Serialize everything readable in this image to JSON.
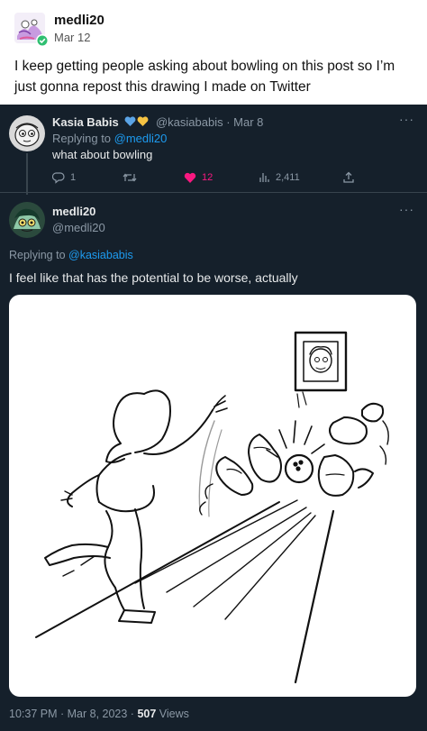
{
  "post": {
    "author": "medli20",
    "date": "Mar 12",
    "text": "I keep getting people asking about bowling on this post so I’m just gonna repost this drawing I made on Twitter"
  },
  "reply_tweet": {
    "name": "Kasia Babis",
    "handle": "@kasiababis",
    "separator": "·",
    "date": "Mar 8",
    "replying_prefix": "Replying to ",
    "replying_mention": "@medli20",
    "text": "what about bowling",
    "more_label": "···",
    "stats": {
      "replies": "1",
      "likes": "12",
      "views": "2,411"
    },
    "like_color": "#f91880"
  },
  "main_tweet": {
    "name": "medli20",
    "handle": "@medli20",
    "more_label": "···",
    "replying_prefix": "Replying to ",
    "replying_mention": "@kasiababis",
    "text": "I feel like that has the potential to be worse, actually",
    "meta_time": "10:37 PM · Mar 8, 2023 · ",
    "views_count": "507",
    "views_label": " Views"
  },
  "icons": [
    "reply-icon",
    "retweet-icon",
    "heart-icon",
    "views-icon",
    "share-icon",
    "verified-badge-icon"
  ],
  "colors": {
    "twitter_bg": "#15202b",
    "mention": "#1d9bf0",
    "muted": "#8b98a5",
    "text_light": "#e7e9ea"
  }
}
